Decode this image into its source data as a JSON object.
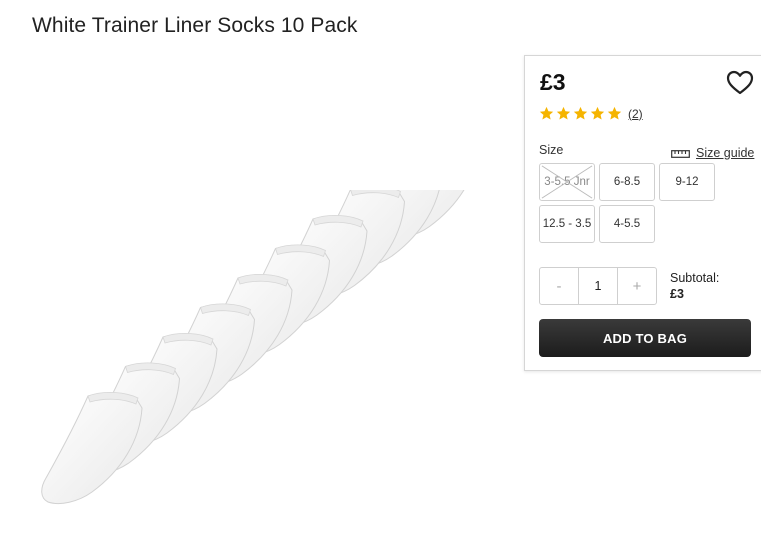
{
  "product": {
    "title": "White Trainer Liner Socks 10 Pack",
    "price": "£3",
    "rating": 5,
    "review_count": "(2)",
    "wishlist_icon": "heart-outline-icon",
    "star_color": "#f5b400"
  },
  "size": {
    "label": "Size",
    "guide_label": "Size guide",
    "guide_icon": "ruler-icon",
    "options": [
      {
        "label": "3-5.5 Jnr",
        "available": false
      },
      {
        "label": "6-8.5",
        "available": true
      },
      {
        "label": "9-12",
        "available": true
      },
      {
        "label": "12.5 - 3.5",
        "available": true
      },
      {
        "label": "4-5.5",
        "available": true
      }
    ]
  },
  "quantity": {
    "minus": "-",
    "value": "1",
    "plus": "+"
  },
  "subtotal": {
    "label": "Subtotal:",
    "value": "£3"
  },
  "cta": {
    "add_to_bag": "ADD TO BAG"
  }
}
